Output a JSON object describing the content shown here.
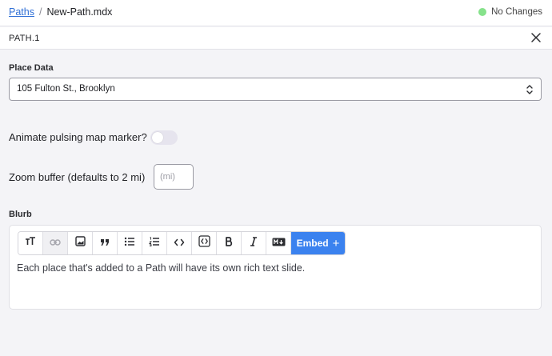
{
  "breadcrumb": {
    "root": "Paths",
    "separator": "/",
    "current": "New-Path.mdx"
  },
  "status": {
    "text": "No Changes",
    "color": "#86e28b"
  },
  "panel": {
    "title": "PATH.1",
    "close_icon": "close-icon"
  },
  "place": {
    "label": "Place Data",
    "value": "105 Fulton St., Brooklyn"
  },
  "animate": {
    "label": "Animate pulsing map marker?",
    "enabled": false
  },
  "zoom": {
    "label": "Zoom buffer (defaults to 2 mi)",
    "placeholder": "(mi)",
    "value": ""
  },
  "blurb": {
    "label": "Blurb",
    "toolbar": [
      {
        "name": "text-size-icon",
        "disabled": false
      },
      {
        "name": "link-icon",
        "disabled": true
      },
      {
        "name": "image-icon",
        "disabled": false
      },
      {
        "name": "quote-icon",
        "disabled": false
      },
      {
        "name": "bullet-list-icon",
        "disabled": false
      },
      {
        "name": "numbered-list-icon",
        "disabled": false
      },
      {
        "name": "code-icon",
        "disabled": false
      },
      {
        "name": "code-block-icon",
        "disabled": false
      },
      {
        "name": "bold-icon",
        "disabled": false
      },
      {
        "name": "italic-icon",
        "disabled": false
      },
      {
        "name": "markdown-icon",
        "disabled": false
      }
    ],
    "embed_label": "Embed",
    "embed_plus": "+",
    "content": "Each place that's added to a Path will have its own rich text slide.",
    "accent": "#3b82ef"
  }
}
